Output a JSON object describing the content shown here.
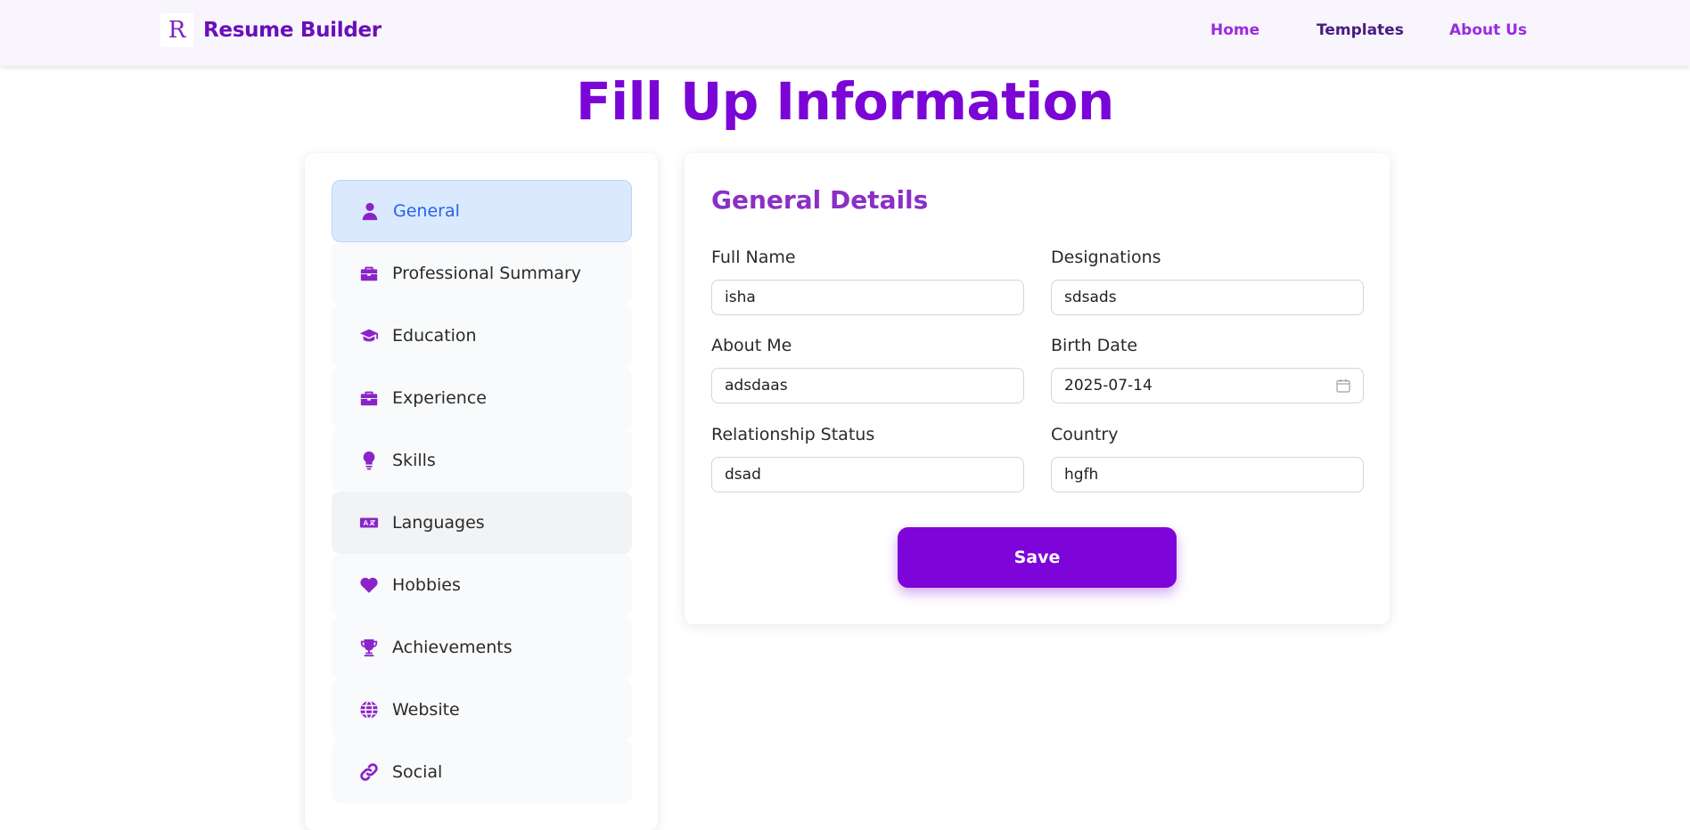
{
  "brand": {
    "logo_letter": "R",
    "name": "Resume Builder"
  },
  "nav": {
    "home": "Home",
    "templates": "Templates",
    "about": "About Us"
  },
  "page": {
    "title": "Fill Up Information"
  },
  "sidebar": {
    "items": [
      {
        "label": "General",
        "icon": "user-icon"
      },
      {
        "label": "Professional Summary",
        "icon": "briefcase-icon"
      },
      {
        "label": "Education",
        "icon": "graduation-cap-icon"
      },
      {
        "label": "Experience",
        "icon": "briefcase-icon"
      },
      {
        "label": "Skills",
        "icon": "lightbulb-icon"
      },
      {
        "label": "Languages",
        "icon": "language-icon"
      },
      {
        "label": "Hobbies",
        "icon": "heart-icon"
      },
      {
        "label": "Achievements",
        "icon": "trophy-icon"
      },
      {
        "label": "Website",
        "icon": "globe-icon"
      },
      {
        "label": "Social",
        "icon": "link-icon"
      }
    ]
  },
  "form": {
    "title": "General Details",
    "full_name": {
      "label": "Full Name",
      "value": "isha"
    },
    "designations": {
      "label": "Designations",
      "value": "sdsads"
    },
    "about_me": {
      "label": "About Me",
      "value": "adsdaas"
    },
    "birth_date": {
      "label": "Birth Date",
      "value": "2025-07-14"
    },
    "relationship_status": {
      "label": "Relationship Status",
      "value": "dsad"
    },
    "country": {
      "label": "Country",
      "value": "hgfh"
    },
    "save_label": "Save"
  },
  "colors": {
    "accent": "#7d05d9",
    "title": "#7b05d6",
    "icon": "#8a24c8",
    "active_bg": "#dbe9fe",
    "active_text": "#2563eb"
  }
}
